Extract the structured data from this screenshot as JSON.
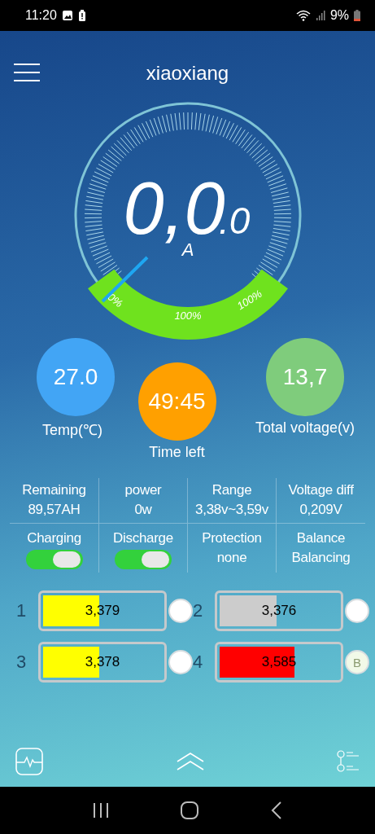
{
  "status_bar": {
    "time": "11:20",
    "battery_text": "9%"
  },
  "header": {
    "title": "xiaoxiang"
  },
  "gauge": {
    "value": "0,0",
    "decimal": ".0",
    "unit": "A",
    "scale_labels": [
      "0%",
      "100%",
      "100%"
    ]
  },
  "stats": [
    {
      "value": "27.0",
      "label": "Temp(℃)",
      "color": "#42a5f5"
    },
    {
      "value": "49:45",
      "label": "Time left",
      "color": "#ffa000"
    },
    {
      "value": "13,7",
      "label": "Total voltage(v)",
      "color": "#7fcc7c"
    }
  ],
  "info": [
    {
      "label": "Remaining",
      "value": "89,57AH"
    },
    {
      "label": "power",
      "value": "0w"
    },
    {
      "label": "Range",
      "value": "3,38v~3,59v"
    },
    {
      "label": "Voltage diff",
      "value": "0,209V"
    }
  ],
  "controls": [
    {
      "kind": "switch",
      "label": "Charging",
      "on": true
    },
    {
      "kind": "switch",
      "label": "Discharge",
      "on": true
    },
    {
      "kind": "text",
      "label": "Protection",
      "value": "none"
    },
    {
      "kind": "text",
      "label": "Balance",
      "value": "Balancing"
    }
  ],
  "cells": [
    {
      "number": "1",
      "voltage": "3,379",
      "level": 0.47,
      "color": "#ffff00",
      "balancing": false
    },
    {
      "number": "2",
      "voltage": "3,376",
      "level": 0.48,
      "color": "#cccccc",
      "balancing": false
    },
    {
      "number": "3",
      "voltage": "3,378",
      "level": 0.47,
      "color": "#ffff00",
      "balancing": false
    },
    {
      "number": "4",
      "voltage": "3,585",
      "level": 0.63,
      "color": "#ff0000",
      "balancing": true,
      "badge": "B"
    }
  ]
}
